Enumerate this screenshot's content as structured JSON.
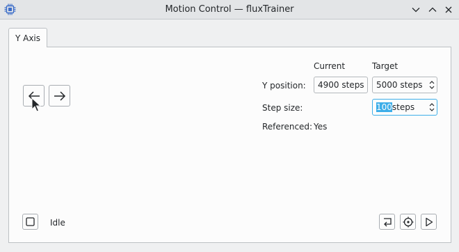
{
  "window": {
    "title": "Motion Control — fluxTrainer",
    "icon": "chip-icon",
    "controls": [
      "minimize-icon",
      "maximize-icon",
      "close-icon"
    ]
  },
  "tabs": [
    {
      "label": "Y Axis",
      "active": true
    }
  ],
  "jog": {
    "left_icon": "arrow-left-icon",
    "right_icon": "arrow-right-icon"
  },
  "columns": {
    "current": "Current",
    "target": "Target"
  },
  "position": {
    "label": "Y position:",
    "current_value": "4900 steps",
    "target_value": "5000 steps"
  },
  "step": {
    "label": "Step size:",
    "value_selected": "100",
    "value_suffix": "steps"
  },
  "referenced": {
    "label": "Referenced:",
    "value": "Yes"
  },
  "status": {
    "checkbox_checked": false,
    "text": "Idle"
  },
  "actions": [
    "return-icon",
    "reference-target-icon",
    "play-icon"
  ],
  "colors": {
    "accent": "#3daee9",
    "window_bg": "#eff0f1",
    "panel_bg": "#fcfcfc"
  }
}
